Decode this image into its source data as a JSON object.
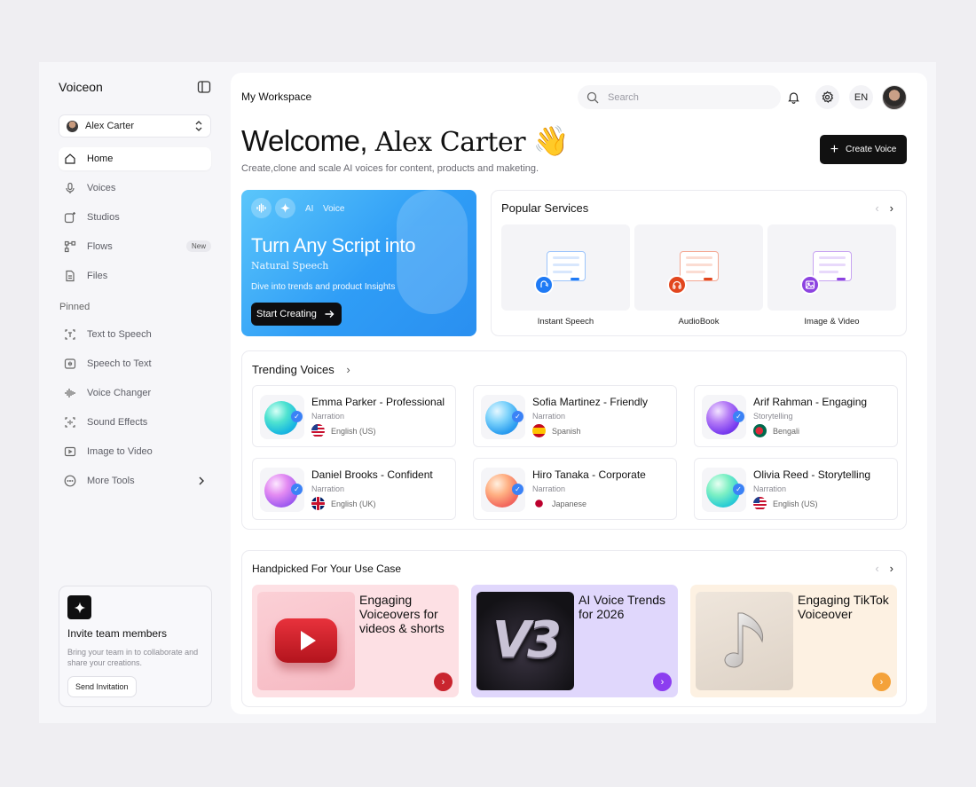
{
  "sidebar": {
    "brand": "Voiceon",
    "profile_name": "Alex Carter",
    "nav": [
      {
        "label": "Home"
      },
      {
        "label": "Voices"
      },
      {
        "label": "Studios"
      },
      {
        "label": "Flows",
        "badge": "New"
      },
      {
        "label": "Files"
      }
    ],
    "pinned_label": "Pinned",
    "pinned": [
      {
        "label": "Text to Speech"
      },
      {
        "label": "Speech to Text"
      },
      {
        "label": "Voice Changer"
      },
      {
        "label": "Sound Effects"
      },
      {
        "label": "Image to Video"
      },
      {
        "label": "More Tools"
      }
    ],
    "invite": {
      "title": "Invite team members",
      "desc": "Bring your team in to collaborate and share your creations.",
      "button": "Send Invitation"
    }
  },
  "header": {
    "workspace": "My Workspace",
    "search_placeholder": "Search",
    "lang": "EN"
  },
  "welcome": {
    "greeting": "Welcome,",
    "name": "Alex Carter",
    "emoji": "👋",
    "subtitle": "Create,clone and scale AI voices for content, products and maketing.",
    "create_button": "Create Voice"
  },
  "hero": {
    "tag_ai": "AI",
    "tag_voice": "Voice",
    "headline": "Turn Any Script into",
    "subheadline": "Natural Speech",
    "desc": "Dive into trends and product Insights",
    "button": "Start Creating"
  },
  "popular": {
    "title": "Popular Services",
    "items": [
      {
        "label": "Instant Speech",
        "color": "#1f7af5"
      },
      {
        "label": "AudioBook",
        "color": "#e2461e"
      },
      {
        "label": "Image & Video",
        "color": "#8c43e0"
      }
    ]
  },
  "trending": {
    "title": "Trending Voices",
    "voices": [
      {
        "name": "Emma Parker - Professional",
        "category": "Narration",
        "language": "English (US)"
      },
      {
        "name": "Sofia Martinez - Friendly",
        "category": "Narration",
        "language": "Spanish"
      },
      {
        "name": "Arif Rahman - Engaging",
        "category": "Storytelling",
        "language": "Bengali"
      },
      {
        "name": "Daniel Brooks - Confident",
        "category": "Narration",
        "language": "English (UK)"
      },
      {
        "name": "Hiro Tanaka - Corporate",
        "category": "Narration",
        "language": "Japanese"
      },
      {
        "name": "Olivia Reed - Storytelling",
        "category": "Narration",
        "language": "English (US)"
      }
    ]
  },
  "handpicked": {
    "title": "Handpicked For Your Use Case",
    "items": [
      {
        "text": "Engaging Voiceovers for videos & shorts",
        "bg": "#fde0e4",
        "accent": "#c9252f"
      },
      {
        "text": "AI Voice Trends for 2026",
        "bg": "#e0d7fc",
        "accent": "#8c3ef0",
        "thumb_text": "V3"
      },
      {
        "text": "Engaging TikTok Voiceover",
        "bg": "#fdf1e2",
        "accent": "#f4a23a"
      }
    ]
  }
}
